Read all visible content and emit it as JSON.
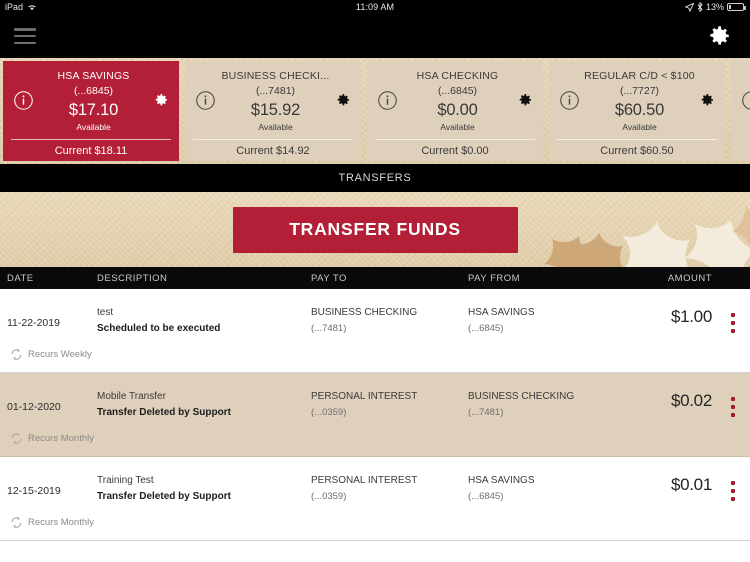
{
  "status_bar": {
    "device": "iPad",
    "wifi_icon": "wifi-icon",
    "time": "11:09 AM",
    "location_icon": "location-arrow-icon",
    "bluetooth_icon": "bluetooth-icon",
    "battery_percent": "13%",
    "battery_icon": "battery-icon"
  },
  "nav": {
    "menu_icon": "hamburger-menu-icon",
    "settings_icon": "gear-icon"
  },
  "accounts": [
    {
      "name": "HSA SAVINGS",
      "number": "(...6845)",
      "balance": "$17.10",
      "available_label": "Available",
      "current": "Current $18.11",
      "selected": true,
      "info_icon": "info-icon",
      "gear_icon": "gear-icon"
    },
    {
      "name": "BUSINESS CHECKI...",
      "number": "(...7481)",
      "balance": "$15.92",
      "available_label": "Available",
      "current": "Current $14.92",
      "selected": false,
      "info_icon": "info-icon",
      "gear_icon": "gear-icon"
    },
    {
      "name": "HSA CHECKING",
      "number": "(...6845)",
      "balance": "$0.00",
      "available_label": "Available",
      "current": "Current $0.00",
      "selected": false,
      "info_icon": "info-icon",
      "gear_icon": "gear-icon"
    },
    {
      "name": "REGULAR C/D < $100",
      "number": "(...7727)",
      "balance": "$60.50",
      "available_label": "Available",
      "current": "Current $60.50",
      "selected": false,
      "info_icon": "info-icon",
      "gear_icon": "gear-icon"
    }
  ],
  "section": {
    "title": "TRANSFERS"
  },
  "banner": {
    "transfer_button": "TRANSFER FUNDS"
  },
  "table": {
    "headers": {
      "date": "DATE",
      "description": "DESCRIPTION",
      "pay_to": "PAY TO",
      "pay_from": "PAY FROM",
      "amount": "AMOUNT"
    },
    "rows": [
      {
        "date": "11-22-2019",
        "description": "test",
        "status": "Scheduled to be executed",
        "pay_to": "BUSINESS CHECKING",
        "pay_to_num": "(...7481)",
        "pay_from": "HSA SAVINGS",
        "pay_from_num": "(...6845)",
        "amount": "$1.00",
        "recurrence": "Recurs Weekly",
        "recur_icon": "repeat-icon",
        "menu_icon": "kebab-menu-icon"
      },
      {
        "date": "01-12-2020",
        "description": "Mobile Transfer",
        "status": "Transfer Deleted by Support",
        "pay_to": "PERSONAL INTEREST",
        "pay_to_num": "(...0359)",
        "pay_from": "BUSINESS CHECKING",
        "pay_from_num": "(...7481)",
        "amount": "$0.02",
        "recurrence": "Recurs Monthly",
        "recur_icon": "repeat-icon",
        "menu_icon": "kebab-menu-icon"
      },
      {
        "date": "12-15-2019",
        "description": "Training Test",
        "status": "Transfer Deleted by Support",
        "pay_to": "PERSONAL INTEREST",
        "pay_to_num": "(...0359)",
        "pay_from": "HSA SAVINGS",
        "pay_from_num": "(...6845)",
        "amount": "$0.01",
        "recurrence": "Recurs Monthly",
        "recur_icon": "repeat-icon",
        "menu_icon": "kebab-menu-icon"
      }
    ]
  },
  "colors": {
    "brand_red": "#b31f36",
    "card_beige": "#ded0bb",
    "strip_tan": "#e4d2b4",
    "bar_black": "#000000"
  }
}
